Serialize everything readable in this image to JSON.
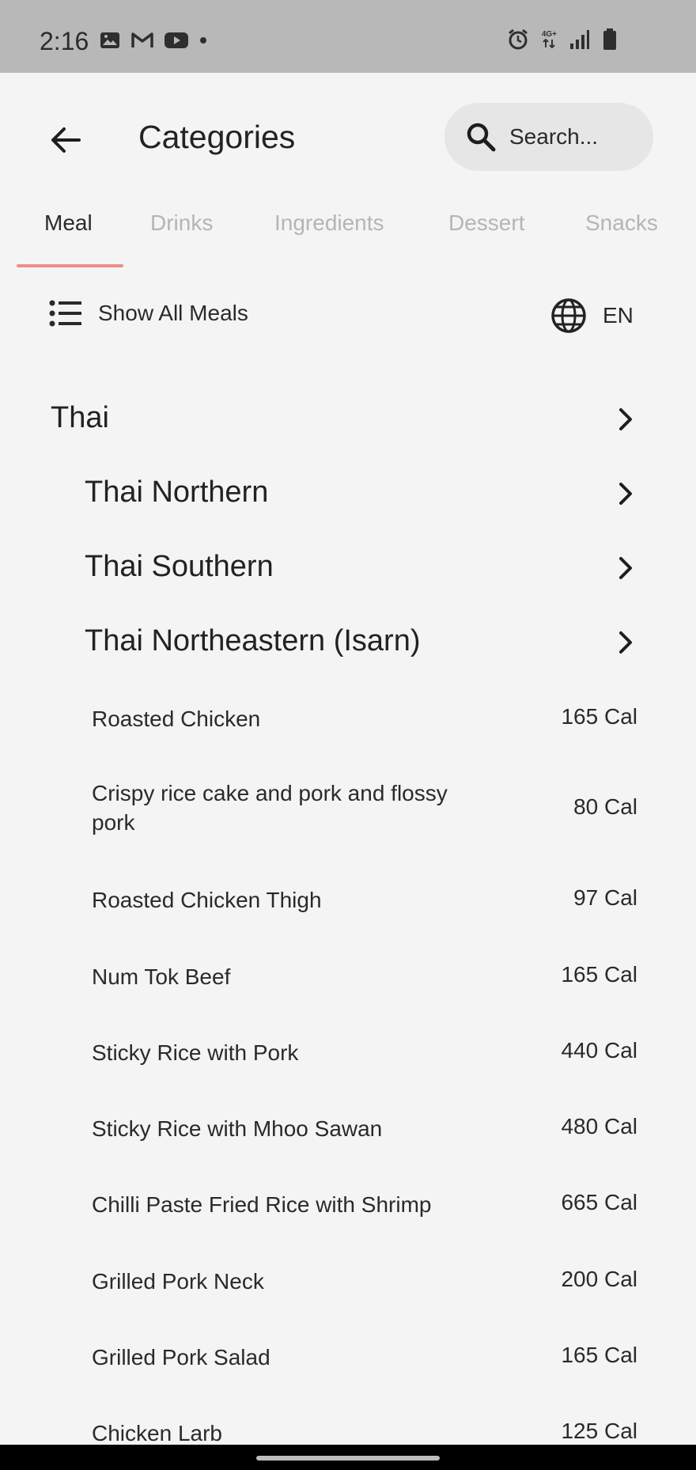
{
  "status": {
    "time": "2:16",
    "left_icons": [
      "image-icon",
      "gmail-icon",
      "youtube-icon",
      "dot-icon"
    ],
    "right_icons": [
      "alarm-icon",
      "4g-plus-icon",
      "signal-icon",
      "battery-icon"
    ],
    "network_label": "4G+"
  },
  "header": {
    "title": "Categories",
    "search_placeholder": "Search..."
  },
  "tabs": [
    "Meal",
    "Drinks",
    "Ingredients",
    "Dessert",
    "Snacks"
  ],
  "active_tab": "Meal",
  "toolbar": {
    "show_all_label": "Show All Meals",
    "language": "EN"
  },
  "categories": {
    "main": "Thai",
    "subs": [
      "Thai Northern",
      "Thai Southern",
      "Thai Northeastern (Isarn)"
    ]
  },
  "meals": [
    {
      "name": "Roasted Chicken",
      "cal": "165 Cal"
    },
    {
      "name": "Crispy rice cake and pork and flossy pork",
      "cal": "80 Cal"
    },
    {
      "name": "Roasted Chicken Thigh",
      "cal": "97 Cal"
    },
    {
      "name": "Num Tok Beef",
      "cal": "165 Cal"
    },
    {
      "name": "Sticky Rice with Pork",
      "cal": "440 Cal"
    },
    {
      "name": "Sticky Rice with Mhoo Sawan",
      "cal": "480 Cal"
    },
    {
      "name": "Chilli Paste Fried Rice with Shrimp",
      "cal": "665 Cal"
    },
    {
      "name": "Grilled Pork Neck",
      "cal": "200 Cal"
    },
    {
      "name": "Grilled Pork Salad",
      "cal": "165 Cal"
    },
    {
      "name": "Chicken Larb",
      "cal": "125 Cal"
    }
  ],
  "colors": {
    "background": "#f4f4f4",
    "status_bar": "#b8b8b8",
    "tab_indicator": "#ef8c8c",
    "search_bg": "#e6e6e6"
  }
}
